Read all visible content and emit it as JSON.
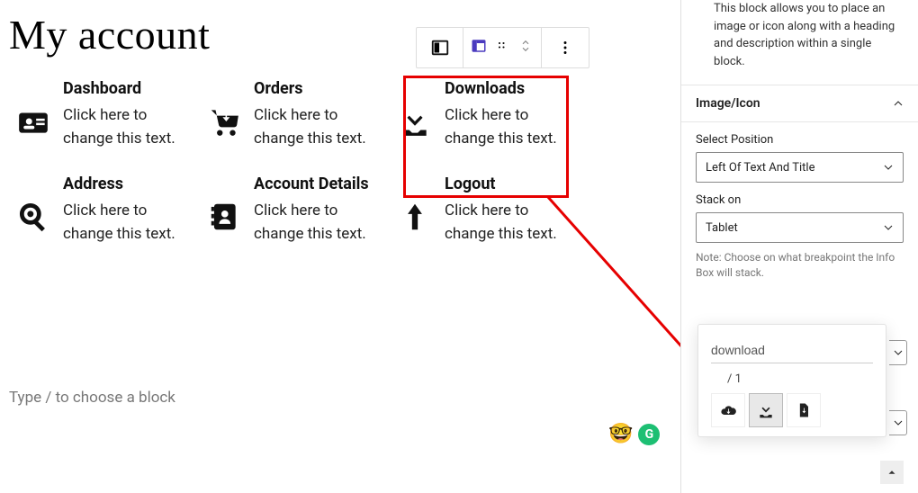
{
  "page": {
    "title": "My account"
  },
  "editor": {
    "placeholder_text": "Type / to choose a block"
  },
  "info_boxes": [
    {
      "key": "dashboard",
      "title": "Dashboard",
      "desc": "Click here to change this text.",
      "icon": "id-card-icon"
    },
    {
      "key": "orders",
      "title": "Orders",
      "desc": "Click here to change this text.",
      "icon": "cart-down-icon"
    },
    {
      "key": "downloads",
      "title": "Downloads",
      "desc": "Click here to change this text.",
      "icon": "download-icon",
      "selected": true
    },
    {
      "key": "address",
      "title": "Address",
      "desc": "Click here to change this text.",
      "icon": "map-pin-search-icon"
    },
    {
      "key": "account",
      "title": "Account Details",
      "desc": "Click here to change this text.",
      "icon": "address-book-icon"
    },
    {
      "key": "logout",
      "title": "Logout",
      "desc": "Click here to change this text.",
      "icon": "arrow-up-icon"
    }
  ],
  "sidebar": {
    "block_description": "This block allows you to place an image or icon along with a heading and description within a single block.",
    "panel_title": "Image/Icon",
    "fields": {
      "position": {
        "label": "Select Position",
        "value": "Left Of Text And Title"
      },
      "stack": {
        "label": "Stack on",
        "value": "Tablet"
      }
    },
    "note": "Note: Choose on what breakpoint the Info Box will stack."
  },
  "icon_picker": {
    "search_value": "download",
    "count_sep": "/",
    "count_total": "1",
    "results": [
      "cloud-download-icon",
      "download-icon",
      "file-download-icon"
    ],
    "selected_index": 1
  }
}
